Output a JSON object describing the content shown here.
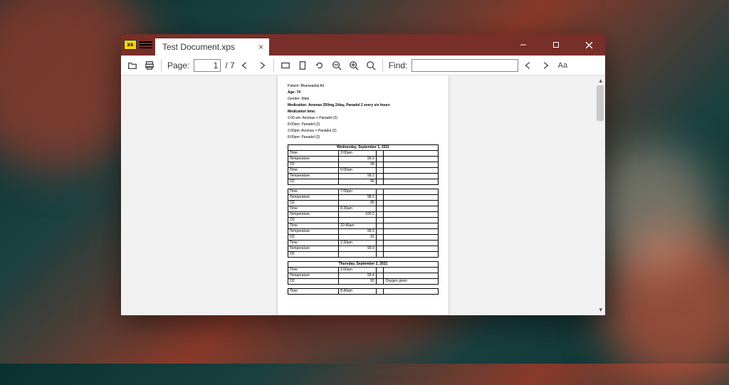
{
  "tab_title": "Test Document.xps",
  "toolbar": {
    "page_label": "Page:",
    "page_current": "1",
    "page_total": "/ 7",
    "find_label": "Find:",
    "find_value": ""
  },
  "doc": {
    "patient": "Patient: Bhanwarilal Ali",
    "age": "Age: 74",
    "gender": "Gender: Male",
    "medication": "Medication: Avomax 250mg 2/day, Panadol 2 every six hours",
    "med_time_label": "Medication time:",
    "t1": "2:00 am: Avomax + Panadol (2)",
    "t2": "8:00am: Panadol (2)",
    "t3": "2:00pm: Avomax + Panadol (2)",
    "t4": "8:00pm: Panadol (2)",
    "day1_header": "Wednesday, September 1, 2021",
    "day2_header": "Thursday, September 2, 2021",
    "labelTime": "Time",
    "labelTemp": "Temperature",
    "labelO2": "O2",
    "note_oxygen": "Oxygen given",
    "rows_day1": [
      {
        "time": "2:00am",
        "temp": "99.9",
        "o2": "98"
      },
      {
        "time": "6:00am",
        "temp": "99.2",
        "o2": "96"
      },
      {
        "time": "7:00pm",
        "temp": "98.9",
        "o2": "95"
      },
      {
        "time": "8:30am",
        "temp": "100.2",
        "o2": ""
      },
      {
        "time": "10:45am",
        "temp": "99.3",
        "o2": "92"
      },
      {
        "time": "2:30pm",
        "temp": "99.9",
        "o2": ""
      }
    ],
    "rows_day2": [
      {
        "time": "2:00am",
        "temp": "99.4",
        "o2": "92"
      },
      {
        "time": "8:40am",
        "temp": "",
        "o2": ""
      }
    ]
  }
}
